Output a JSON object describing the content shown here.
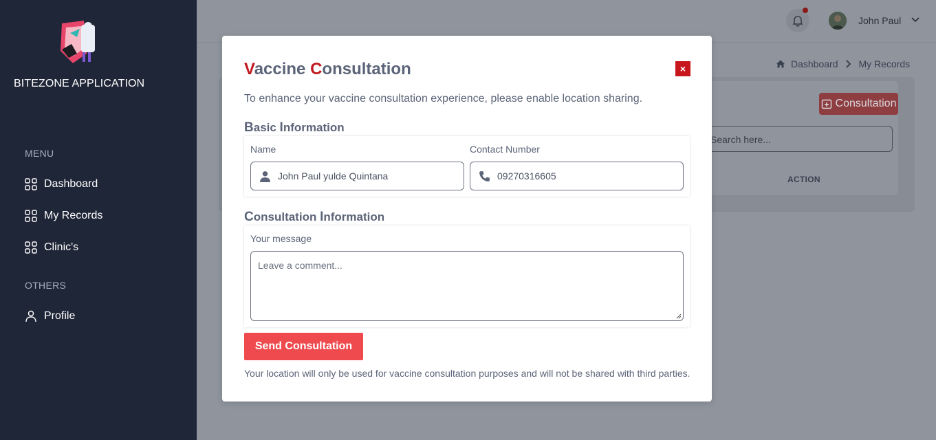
{
  "sidebar": {
    "app_name": "BITEZONE APPLICATION",
    "menu_label": "MENU",
    "items": [
      {
        "label": "Dashboard",
        "icon": "grid-icon"
      },
      {
        "label": "My Records",
        "icon": "grid-icon"
      },
      {
        "label": "Clinic's",
        "icon": "grid-icon"
      }
    ],
    "others_label": "OTHERS",
    "profile_label": "Profile"
  },
  "header": {
    "user_name": "John Paul"
  },
  "breadcrumb": {
    "home": "Dashboard",
    "current": "My Records"
  },
  "background_page": {
    "consultation_button": "Consultation",
    "search_placeholder": "Search here...",
    "table_header_action": "ACTION"
  },
  "modal": {
    "title_first_letter": "V",
    "title_word1_rest": "accine ",
    "title_second_letter": "C",
    "title_word2_rest": "onsultation",
    "intro": "To enhance your vaccine consultation experience, please enable location sharing.",
    "basic_section": {
      "cap": "B",
      "rest": "asic ",
      "cap2": "I",
      "rest2": "nformation"
    },
    "name_label": "Name",
    "name_value": "John Paul yulde Quintana",
    "contact_label": "Contact Number",
    "contact_value": "09270316605",
    "consult_section": {
      "cap": "C",
      "rest": "onsultation ",
      "cap2": "I",
      "rest2": "nformation"
    },
    "message_label": "Your message",
    "message_placeholder": "Leave a comment...",
    "send_button": "Send Consultation",
    "footnote": "Your location will only be used for vaccine consultation purposes and will not be shared with third parties.",
    "close_symbol": "×"
  },
  "colors": {
    "sidebar_bg": "#1f2637",
    "accent_red": "#c0191f",
    "button_red": "#ef4b4f"
  }
}
